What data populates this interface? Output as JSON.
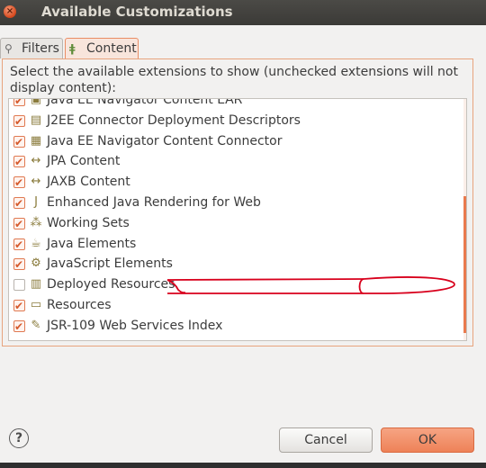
{
  "window": {
    "title": "Available Customizations",
    "close_icon": "×"
  },
  "tabs": [
    {
      "label": "Filters",
      "icon": "filter-icon",
      "active": false
    },
    {
      "label": "Content",
      "icon": "content-icon",
      "active": true
    }
  ],
  "description": "Select the available extensions to show (unchecked extensions will not display content):",
  "items": [
    {
      "label": "Java EE Navigator Content EAR",
      "checked": true,
      "icon": "ear-icon"
    },
    {
      "label": "J2EE Connector Deployment Descriptors",
      "checked": true,
      "icon": "connector-icon"
    },
    {
      "label": "Java EE Navigator Content Connector",
      "checked": true,
      "icon": "navigator-icon"
    },
    {
      "label": "JPA Content",
      "checked": true,
      "icon": "jpa-icon"
    },
    {
      "label": "JAXB Content",
      "checked": true,
      "icon": "jaxb-icon"
    },
    {
      "label": "Enhanced Java Rendering for Web",
      "checked": true,
      "icon": "java-file-icon"
    },
    {
      "label": "Working Sets",
      "checked": true,
      "icon": "working-sets-icon"
    },
    {
      "label": "Java Elements",
      "checked": true,
      "icon": "java-elements-icon"
    },
    {
      "label": "JavaScript Elements",
      "checked": true,
      "icon": "javascript-elements-icon"
    },
    {
      "label": "Deployed Resources",
      "checked": false,
      "icon": "deployed-resources-icon"
    },
    {
      "label": "Resources",
      "checked": true,
      "icon": "folder-icon"
    },
    {
      "label": "JSR-109 Web Services Index",
      "checked": true,
      "icon": "web-services-icon"
    }
  ],
  "buttons": {
    "help": "?",
    "cancel": "Cancel",
    "ok": "OK"
  },
  "colors": {
    "accent": "#ee8258",
    "annotation": "#d8001c"
  }
}
